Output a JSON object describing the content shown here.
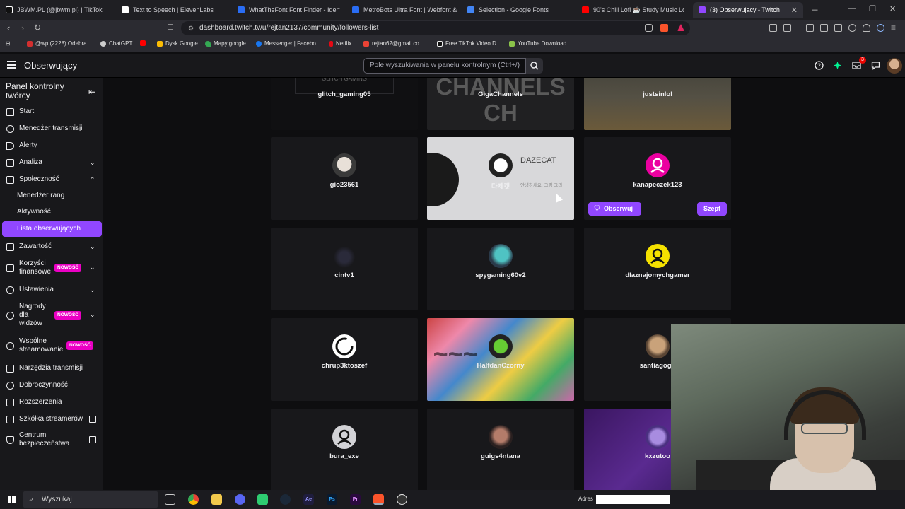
{
  "browser": {
    "tabs": [
      {
        "label": "JBWM.PL (@jbwm.pl) | TikTok",
        "icon": "tiktok-icon",
        "color": "#ffffff"
      },
      {
        "label": "Text to Speech | ElevenLabs",
        "icon": "elevenlabs-icon",
        "color": "#ffffff"
      },
      {
        "label": "WhatTheFont Font Finder - Identify f",
        "icon": "myfonts-icon",
        "color": "#2a6df4"
      },
      {
        "label": "MetroBots Ultra Font | Webfont & D",
        "icon": "myfonts-icon",
        "color": "#2a6df4"
      },
      {
        "label": "Selection - Google Fonts",
        "icon": "google-fonts-icon",
        "color": "#4285f4"
      },
      {
        "label": "90's Chill Lofi ☕ Study Music Lo",
        "icon": "youtube-icon",
        "color": "#ff0000"
      },
      {
        "label": "(3) Obserwujący - Twitch",
        "icon": "twitch-icon",
        "color": "#9147ff"
      }
    ],
    "url": "dashboard.twitch.tv/u/rejtan2137/community/followers-list",
    "bookmarks": [
      {
        "label": "@wp (2228) Odebra...",
        "color": "#d32f2f"
      },
      {
        "label": "ChatGPT",
        "color": "#cccccc"
      },
      {
        "label": "",
        "color": "#ff0000"
      },
      {
        "label": "Dysk Google",
        "color": "#fbbc04"
      },
      {
        "label": "Mapy google",
        "color": "#34a853"
      },
      {
        "label": "Messenger | Facebo...",
        "color": "#1877f2"
      },
      {
        "label": "Netflix",
        "color": "#e50914"
      },
      {
        "label": "rejtan62@gmail.co...",
        "color": "#ea4335"
      },
      {
        "label": "Free TikTok Video D...",
        "color": "#111111"
      },
      {
        "label": "YouTube Download...",
        "color": "#8bc34a"
      }
    ]
  },
  "topnav": {
    "title": "Obserwujący",
    "search_placeholder": "Pole wyszukiwania w panelu kontrolnym (Ctrl+/)",
    "notification_count": "3"
  },
  "sidebar": {
    "title": "Panel kontrolny twórcy",
    "items": [
      {
        "label": "Start"
      },
      {
        "label": "Menedżer transmisji"
      },
      {
        "label": "Alerty"
      },
      {
        "label": "Analiza"
      },
      {
        "label": "Społeczność"
      },
      {
        "label": "Menedżer rang"
      },
      {
        "label": "Aktywność"
      },
      {
        "label": "Lista obserwujących"
      },
      {
        "label": "Zawartość"
      },
      {
        "label": "Korzyści finansowe"
      },
      {
        "label": "Ustawienia"
      },
      {
        "label": "Nagrody dla widzów"
      },
      {
        "label": "Wspólne streamowanie"
      },
      {
        "label": "Narzędzia transmisji"
      },
      {
        "label": "Dobroczynność"
      },
      {
        "label": "Rozszerzenia"
      },
      {
        "label": "Szkółka streamerów"
      },
      {
        "label": "Centrum bezpieczeństwa"
      }
    ],
    "new_badge": "NOWOŚĆ"
  },
  "followers": [
    {
      "name": "glitch_gaming05",
      "banner": "GLITCH GAMING"
    },
    {
      "name": "GigaChannels",
      "banner": "A GIGA G LS CHANNELS CH"
    },
    {
      "name": "justsinlol"
    },
    {
      "name": "gio23561"
    },
    {
      "name": "다제캣",
      "banner": "DAZECAT",
      "banner_sub": "안녕하세요, 그림 그리"
    },
    {
      "name": "kanapeczek123"
    },
    {
      "name": "cintv1"
    },
    {
      "name": "spygaming60v2"
    },
    {
      "name": "dlaznajomychgamer"
    },
    {
      "name": "chrup3ktoszef"
    },
    {
      "name": "HalfdanCzorny"
    },
    {
      "name": "santiagogo"
    },
    {
      "name": "bura_exe"
    },
    {
      "name": "guigs4ntana"
    },
    {
      "name": "kxzutoo"
    }
  ],
  "card_actions": {
    "follow": "Obserwuj",
    "whisper": "Szept"
  },
  "taskbar": {
    "search": "Wyszukaj",
    "address_label": "Adres"
  },
  "colors": {
    "accent": "#9147ff",
    "new_badge": "#eb00c4",
    "bg": "#0e0e10",
    "panel": "#18181b"
  }
}
